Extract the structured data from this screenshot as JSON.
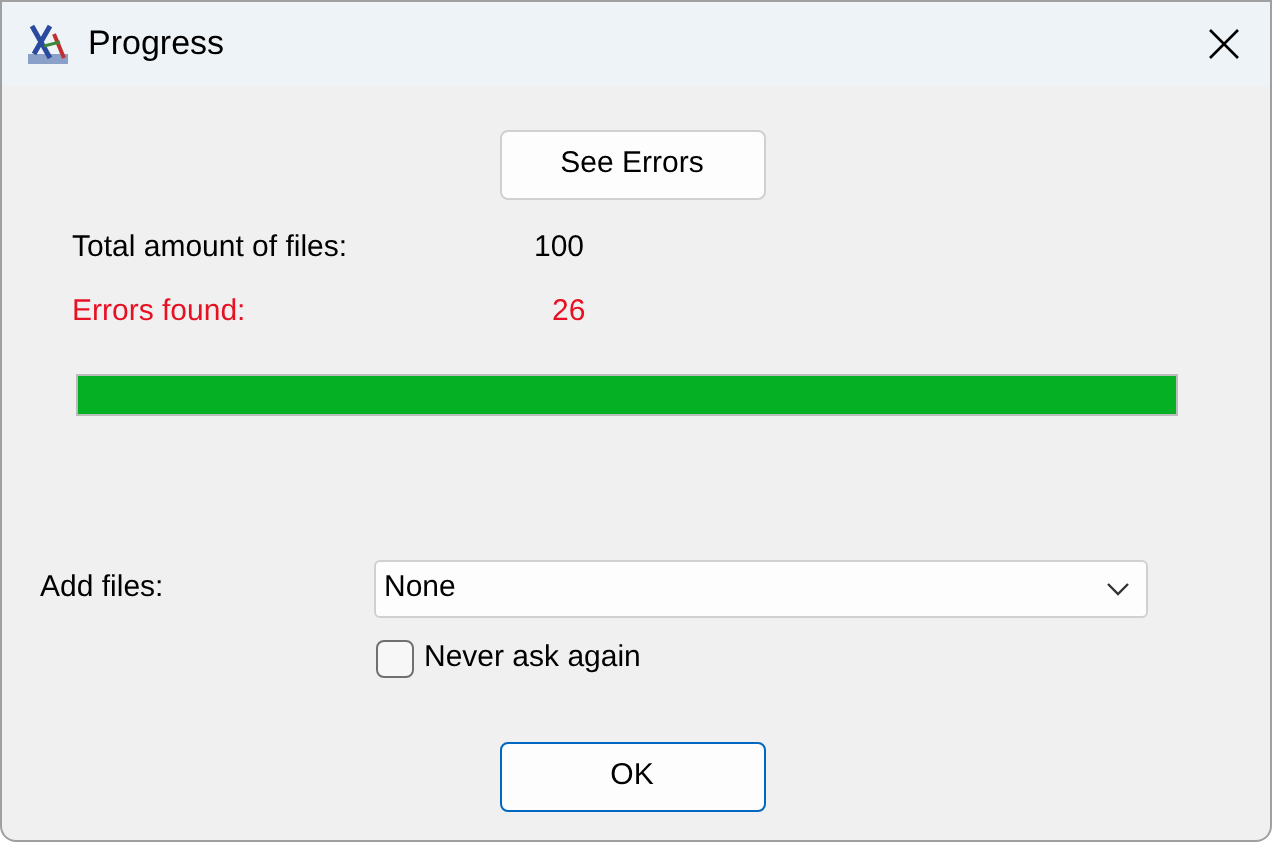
{
  "window": {
    "title": "Progress"
  },
  "see_errors_button": "See Errors",
  "stats": [
    {
      "label": "Total amount of files:",
      "value": "100",
      "kind": "normal"
    },
    {
      "label": "Errors found:",
      "value": "26",
      "kind": "error"
    }
  ],
  "progress": {
    "level": 1
  },
  "add_files": {
    "label": "Add files:",
    "value": "None"
  },
  "never_ask": {
    "label": "Never ask again",
    "checked": false
  },
  "ok_button": "OK"
}
